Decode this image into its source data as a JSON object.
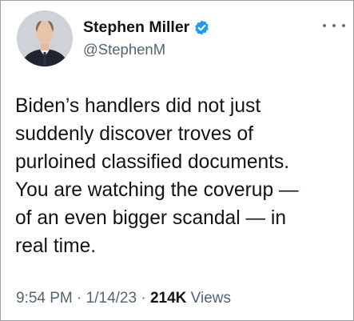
{
  "author": {
    "display_name": "Stephen Miller",
    "handle": "@StephenM",
    "verified": true,
    "avatar": "profile-photo"
  },
  "more_icon": "more-horizontal-icon",
  "tweet": {
    "lines": [
      "Biden’s handlers did not just",
      "suddenly discover troves of",
      "purloined classified documents.",
      "You are watching the coverup —",
      "of an even bigger scandal — in",
      "real time."
    ]
  },
  "meta": {
    "time": "9:54 PM",
    "sep1": " · ",
    "date": "1/14/23",
    "sep2": " · ",
    "views_count": "214K",
    "views_label": " Views"
  },
  "colors": {
    "text": "#0f1419",
    "secondary": "#536471",
    "verified": "#1d9bf0"
  }
}
